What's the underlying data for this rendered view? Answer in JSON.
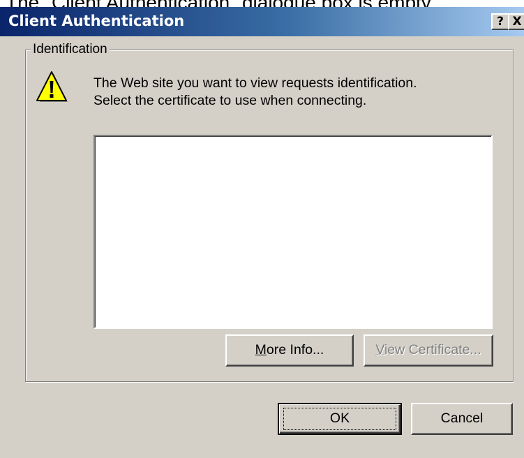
{
  "caption": "The \"Client Authentication\" dialogue box is empty.",
  "dialog": {
    "title": "Client Authentication",
    "help_button": "?",
    "close_button": "X",
    "group_label": "Identification",
    "message_line1": "The Web site you want to view requests identification.",
    "message_line2": "Select the certificate to use when connecting.",
    "certificates": [],
    "more_info": {
      "mnemonic": "M",
      "rest": "ore Info..."
    },
    "view_certificate": {
      "mnemonic": "V",
      "rest": "iew Certificate...",
      "enabled": false
    },
    "ok_label": "OK",
    "cancel_label": "Cancel"
  },
  "colors": {
    "dialog_face": "#d4d0c8",
    "titlebar_start": "#0a246a",
    "titlebar_end": "#a6caf0",
    "warning_yellow": "#ffff00"
  },
  "icons": {
    "warning": "warning-triangle-icon"
  }
}
